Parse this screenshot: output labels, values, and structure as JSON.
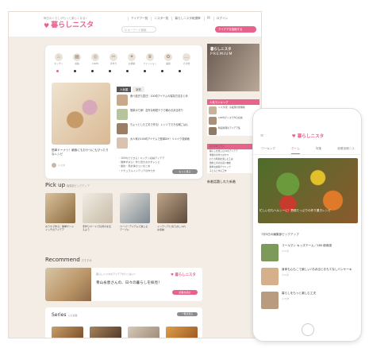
{
  "site": {
    "tagline": "毎日のくらしがもっと楽しくなる♪",
    "name": "暮らしニスタ"
  },
  "desktop": {
    "nav": [
      "アイデア一覧",
      "ニスタ一覧",
      "暮らしニスタ総選挙",
      "ログイン"
    ],
    "search_placeholder": "Q キーワード検索",
    "login_button": "アイデアを投稿する",
    "categories": [
      {
        "label": "キッチン",
        "icon": "kitchen-icon",
        "glyph": "♨"
      },
      {
        "label": "収納",
        "icon": "storage-icon",
        "glyph": "▦"
      },
      {
        "label": "100均",
        "icon": "100yen-icon",
        "glyph": "◎"
      },
      {
        "label": "手作り",
        "icon": "handmade-icon",
        "glyph": "✂"
      },
      {
        "label": "お掃除",
        "icon": "cleaning-icon",
        "glyph": "✦"
      },
      {
        "label": "ファッション",
        "icon": "fashion-icon",
        "glyph": "♛"
      },
      {
        "label": "美容",
        "icon": "beauty-icon",
        "glyph": "✿"
      },
      {
        "label": "その他",
        "icon": "other-icon",
        "glyph": "…"
      }
    ],
    "featured": {
      "title": "簡単ドーナツ！朝食にもおやつにもぴったりなレシピ",
      "author": "ニスタ"
    },
    "tabs": [
      "人気順",
      "新着"
    ],
    "list": [
      "食べ過ぎた翌日！100均アイテムの保存方法まとめ",
      "簡単ゆで卵！意外な時短テクで朝のお弁当作り",
      "ちょっとした工夫で作る！レンジでできる朝ごはん",
      "大人気の100均アイテムで簡単DIY！リメイク収納術"
    ],
    "bullets": [
      "・100均でできる！キッチン収納アイデア",
      "・簡単ずぼら！作り置きおかずレシピ",
      "・節約・家計簿のコツまとめ",
      "・ナチュラルインテリアの作り方"
    ],
    "more_label": "もっと見る",
    "pickup": {
      "title": "Pick up",
      "sub": "編集部ピックアップ",
      "items": [
        "おうちで作る！簡単サンドイッチのアイデア",
        "手作りカードで気持ちを伝えよう",
        "ペーパーアイテムで楽しむテーブル",
        "インテリアに合うおしゃれな収納"
      ]
    },
    "recommend": {
      "title": "Recommend",
      "sub": "おすすめ",
      "tag": "暮らしニスタのアイデアがいっぱい♪",
      "text": "青山永恵さんの、日々の暮らしを拝見！",
      "button": "記事を読む"
    },
    "series": {
      "title": "Series",
      "sub": "人気連載",
      "more": "一覧を見る"
    },
    "sidebar": {
      "premium_logo": "暮らしニスタ",
      "premium_word": "PREMIUM",
      "ranking_head": "人気ランキング",
      "ranking": [
        "ニスタ流！冷蔵庫の整理術",
        "100均グッズで作る収納",
        "時短料理のアイデア集"
      ],
      "column_head": "おすすめコラム",
      "column": [
        "暮らしを楽しむ12のアイデア",
        "季節の手作りおやつ",
        "おうち時間を楽しむ工夫",
        "節約上手のお買い物術",
        "簡単お掃除テクニック",
        "子どもと作る工作"
      ],
      "new_head": "新着話題しれた新着"
    }
  },
  "phone": {
    "logo": "暮らしニスタ",
    "tabs": [
      "ワーキング",
      "ホーム",
      "特集",
      "新着投稿ニス"
    ],
    "active_tab": "ホーム",
    "hero_text": "忙しい日もヘルシーに！野菜たっぷりの作り置きレシピ",
    "date_line": "7月5日の編集部ピックアップ",
    "items": [
      {
        "title": "コールマン キッズテーム／180 使用感",
        "sub": "ニスタ"
      },
      {
        "title": "身体も心もこで楽しい♪お弁当とおもてなしパンケーキ",
        "sub": "ニスタ"
      },
      {
        "title": "暮らしをもっと楽しむ工夫",
        "sub": "ニスタ"
      }
    ]
  }
}
